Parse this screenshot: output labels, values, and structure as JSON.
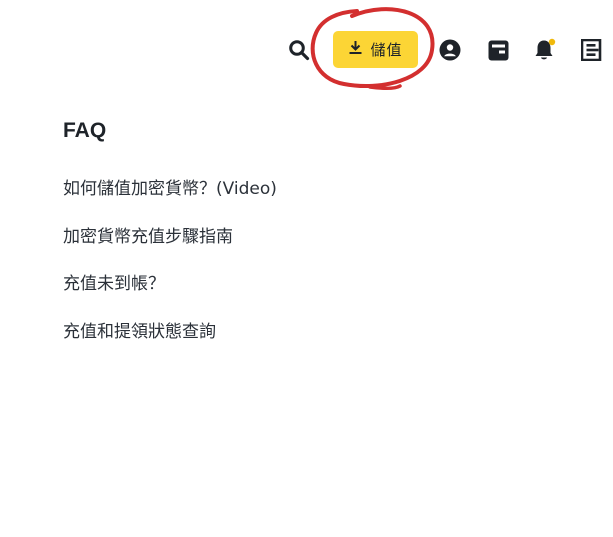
{
  "header": {
    "icons": {
      "search": "search-icon",
      "user": "user-icon",
      "wallet": "wallet-icon",
      "bell": "bell-icon",
      "menu": "menu-icon"
    },
    "deposit": {
      "label": "儲值",
      "icon": "download-icon"
    },
    "notification_dot_color": "#f0b90b",
    "accent_color": "#fcd535",
    "annotation_color": "#d32f2f"
  },
  "faq": {
    "title": "FAQ",
    "items": [
      "如何儲值加密貨幣？(Video)",
      "加密貨幣充值步驟指南",
      "充值未到帳？",
      "充值和提領狀態查詢"
    ]
  }
}
